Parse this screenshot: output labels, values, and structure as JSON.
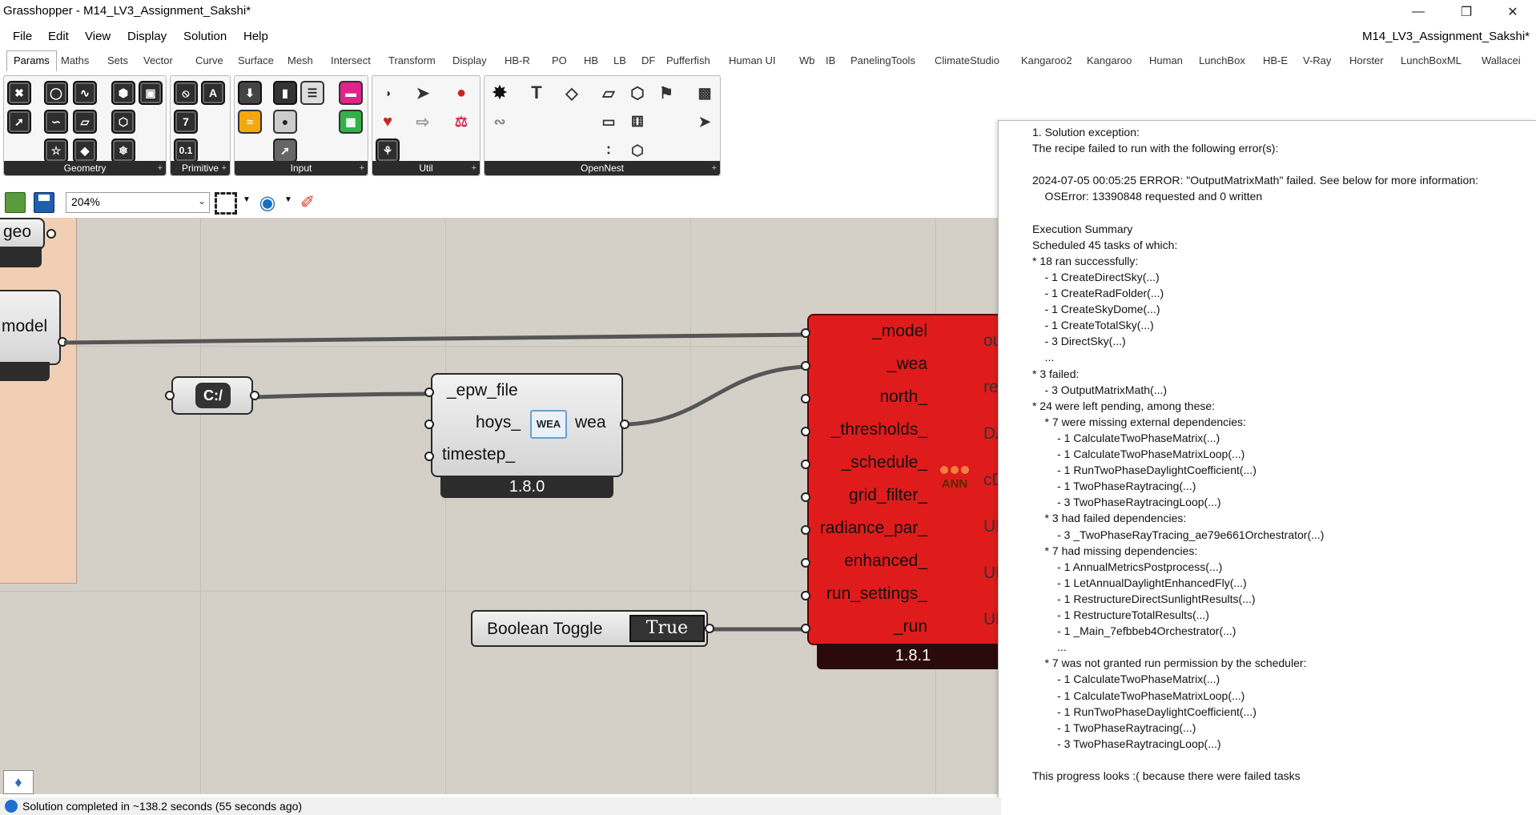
{
  "window": {
    "title": "Grasshopper - M14_LV3_Assignment_Sakshi*",
    "doc_title": "M14_LV3_Assignment_Sakshi*"
  },
  "menu": [
    "File",
    "Edit",
    "View",
    "Display",
    "Solution",
    "Help"
  ],
  "tabs": [
    "Params",
    "Maths",
    "Sets",
    "Vector",
    "Curve",
    "Surface",
    "Mesh",
    "Intersect",
    "Transform",
    "Display",
    "HB-R",
    "PO",
    "HB",
    "LB",
    "DF",
    "Pufferfish",
    "Human UI",
    "Wb",
    "IB",
    "PanelingTools",
    "ClimateStudio",
    "Kangaroo2",
    "Kangaroo",
    "Human",
    "LunchBox",
    "HB-E",
    "V-Ray",
    "Horster",
    "LunchBoxML",
    "Wallacei"
  ],
  "active_tab": "Params",
  "ribbon_groups": [
    "Geometry",
    "Primitive",
    "Input",
    "Util",
    "OpenNest"
  ],
  "toolbar": {
    "zoom": "204%"
  },
  "canvas": {
    "geo_label": "geo",
    "model_label": "model",
    "path_component": "C:/",
    "wea_component": {
      "inputs": [
        "_epw_file",
        "hoys_",
        "timestep_"
      ],
      "output": "wea",
      "icon_text": "WEA",
      "version": "1.8.0"
    },
    "toggle": {
      "label": "Boolean Toggle",
      "value": "True"
    },
    "red_component": {
      "inputs": [
        "_model",
        "_wea",
        "north_",
        "_thresholds_",
        "_schedule_",
        "grid_filter_",
        "radiance_par_",
        "enhanced_",
        "run_settings_",
        "_run"
      ],
      "outputs": [
        "ou",
        "res",
        "DA",
        "cD",
        "UD",
        "UD",
        "UD"
      ],
      "icon_text": "ANN",
      "version": "1.8.1"
    }
  },
  "error_panel": {
    "lines": [
      "1. Solution exception:",
      "The recipe failed to run with the following error(s):",
      "",
      "2024-07-05 00:05:25 ERROR: \"OutputMatrixMath\" failed. See below for more information:",
      "    OSError: 13390848 requested and 0 written",
      "",
      "Execution Summary",
      "Scheduled 45 tasks of which:",
      "* 18 ran successfully:",
      "    - 1 CreateDirectSky(...)",
      "    - 1 CreateRadFolder(...)",
      "    - 1 CreateSkyDome(...)",
      "    - 1 CreateTotalSky(...)",
      "    - 3 DirectSky(...)",
      "    ...",
      "* 3 failed:",
      "    - 3 OutputMatrixMath(...)",
      "* 24 were left pending, among these:",
      "    * 7 were missing external dependencies:",
      "        - 1 CalculateTwoPhaseMatrix(...)",
      "        - 1 CalculateTwoPhaseMatrixLoop(...)",
      "        - 1 RunTwoPhaseDaylightCoefficient(...)",
      "        - 1 TwoPhaseRaytracing(...)",
      "        - 3 TwoPhaseRaytracingLoop(...)",
      "    * 3 had failed dependencies:",
      "        - 3 _TwoPhaseRayTracing_ae79e661Orchestrator(...)",
      "    * 7 had missing dependencies:",
      "        - 1 AnnualMetricsPostprocess(...)",
      "        - 1 LetAnnualDaylightEnhancedFly(...)",
      "        - 1 RestructureDirectSunlightResults(...)",
      "        - 1 RestructureTotalResults(...)",
      "        - 1 _Main_7efbbeb4Orchestrator(...)",
      "        ...",
      "    * 7 was not granted run permission by the scheduler:",
      "        - 1 CalculateTwoPhaseMatrix(...)",
      "        - 1 CalculateTwoPhaseMatrixLoop(...)",
      "        - 1 RunTwoPhaseDaylightCoefficient(...)",
      "        - 1 TwoPhaseRaytracing(...)",
      "        - 3 TwoPhaseRaytracingLoop(...)",
      "",
      "This progress looks :( because there were failed tasks"
    ]
  },
  "status": {
    "text": "Solution completed in ~138.2 seconds (55 seconds ago)"
  },
  "colors": {
    "canvas_bg": "#d4d0c8",
    "component_red": "#e01b1b",
    "cluster_panel": "#f0cfb4",
    "wire": "#555555"
  }
}
